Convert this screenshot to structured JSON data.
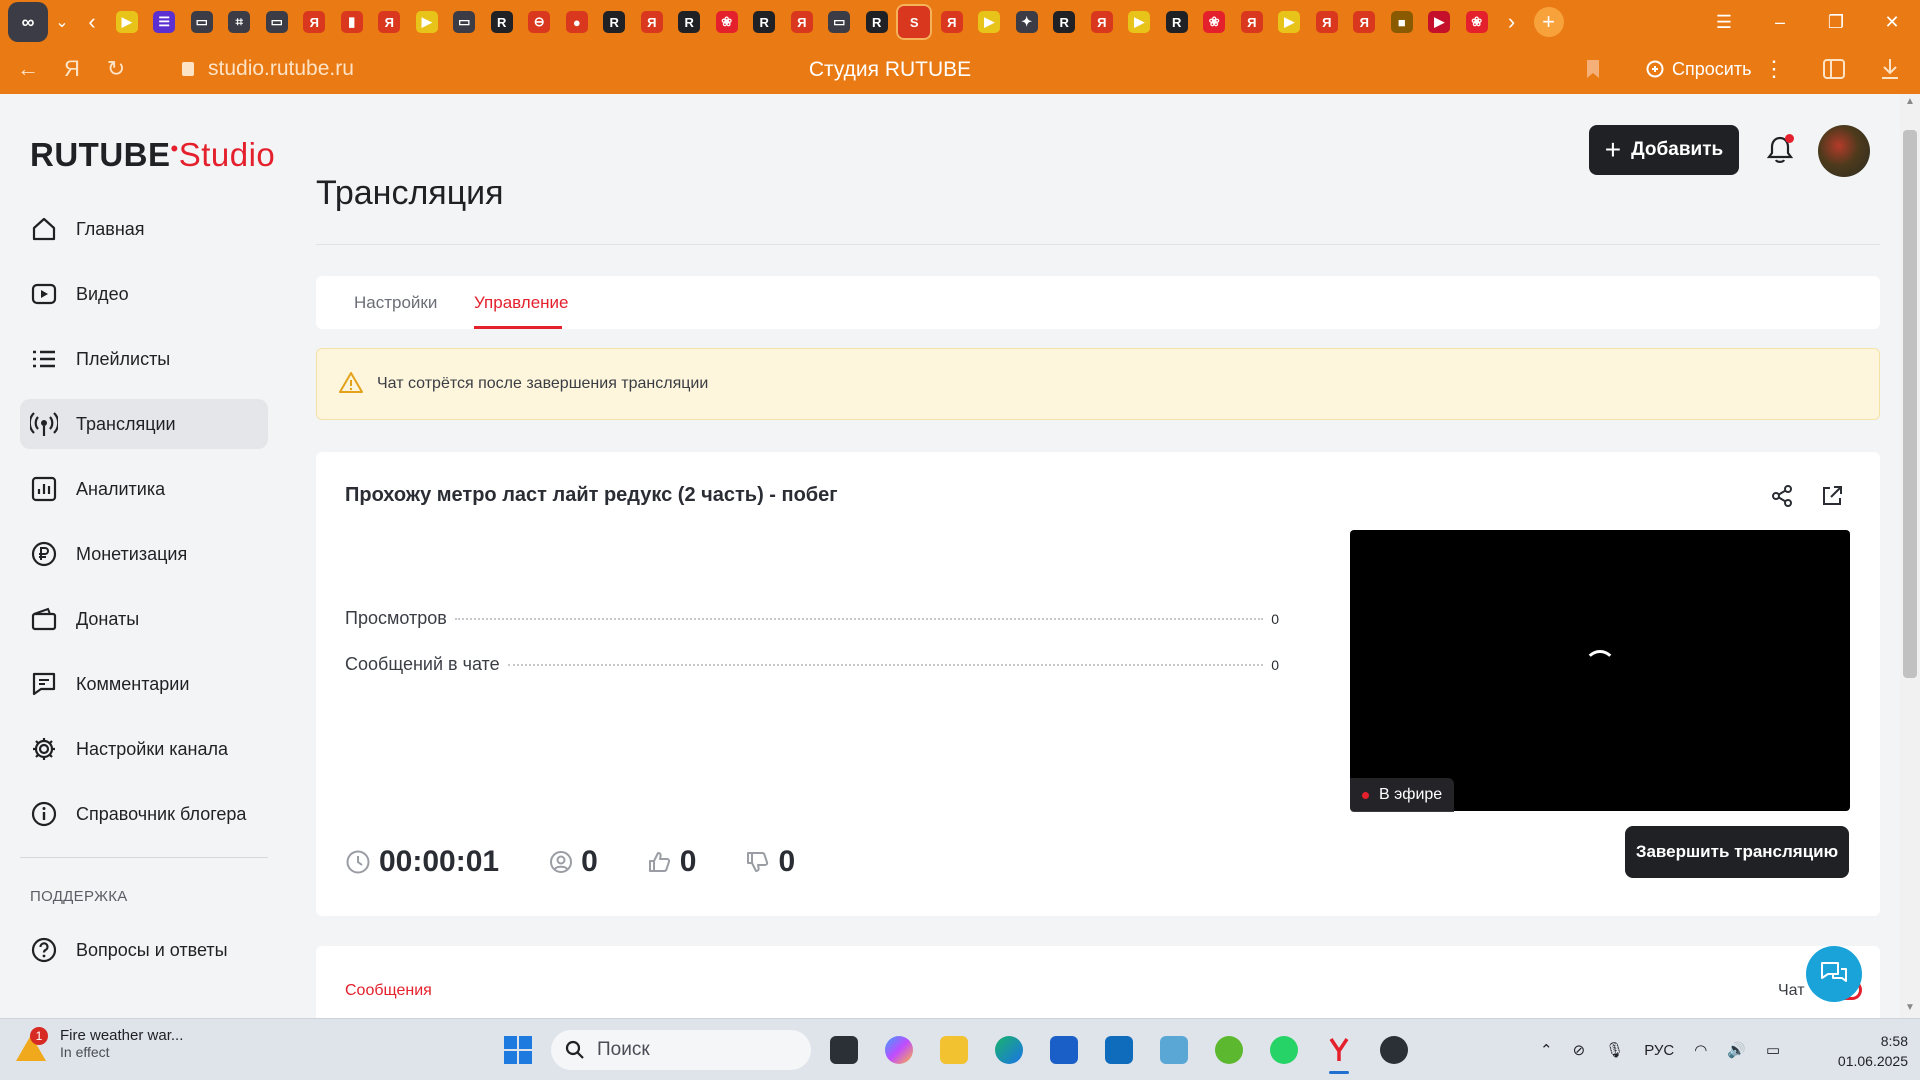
{
  "browser": {
    "url": "studio.rutube.ru",
    "title": "Студия RUTUBE",
    "ask_label": "Спросить",
    "tab_glyphs": [
      "▶",
      "☰",
      "▭",
      "⌗",
      "▭",
      "Я",
      "▮",
      "Я",
      "▶",
      "▭",
      "R",
      "⊖",
      "●",
      "R",
      "Я",
      "R",
      "❀",
      "R",
      "Я",
      "▭",
      "R",
      "S",
      "Я",
      "▶",
      "✦",
      "R",
      "Я",
      "▶",
      "R",
      "❀",
      "Я",
      "▶",
      "Я",
      "Я",
      "■",
      "▶",
      "❀"
    ],
    "tab_colors": [
      "#e8c41a",
      "#5b2fd0",
      "#3c3c46",
      "#3c3c46",
      "#3c3c46",
      "#d9381e",
      "#d9381e",
      "#d9381e",
      "#e8c41a",
      "#3c3c46",
      "#1f2125",
      "#d9381e",
      "#d9381e",
      "#1f2125",
      "#d9381e",
      "#1f2125",
      "#e4202d",
      "#1f2125",
      "#d9381e",
      "#3c3c46",
      "#1f2125",
      "#d9381e",
      "#d9381e",
      "#e8c41a",
      "#3c3c46",
      "#1f2125",
      "#d9381e",
      "#e8c41a",
      "#1f2125",
      "#e4202d",
      "#d9381e",
      "#e8c41a",
      "#d9381e",
      "#d9381e",
      "#8a5a00",
      "#c4102a",
      "#e4202d"
    ]
  },
  "header": {
    "logo_main": "RUTUBE",
    "logo_accent": "Studio",
    "add_label": "Добавить"
  },
  "sidebar": {
    "items": [
      {
        "label": "Главная",
        "icon": "home-icon"
      },
      {
        "label": "Видео",
        "icon": "video-icon"
      },
      {
        "label": "Плейлисты",
        "icon": "playlist-icon"
      },
      {
        "label": "Трансляции",
        "icon": "broadcast-icon",
        "active": true
      },
      {
        "label": "Аналитика",
        "icon": "analytics-icon"
      },
      {
        "label": "Монетизация",
        "icon": "ruble-icon"
      },
      {
        "label": "Донаты",
        "icon": "wallet-icon"
      },
      {
        "label": "Комментарии",
        "icon": "comment-icon"
      },
      {
        "label": "Настройки канала",
        "icon": "gear-icon"
      },
      {
        "label": "Справочник блогера",
        "icon": "info-icon"
      }
    ],
    "support_title": "ПОДДЕРЖКА",
    "support_items": [
      {
        "label": "Вопросы и ответы",
        "icon": "question-icon"
      }
    ]
  },
  "main": {
    "page_title": "Трансляция",
    "tabs": [
      {
        "label": "Настройки"
      },
      {
        "label": "Управление",
        "active": true
      }
    ],
    "warning": "Чат сотрётся после завершения трансляции",
    "stream": {
      "title": "Прохожу метро ласт лайт редукс (2 часть) - побег",
      "stats": [
        {
          "label": "Просмотров",
          "value": "0"
        },
        {
          "label": "Сообщений в чате",
          "value": "0"
        }
      ],
      "live_label": "В эфире",
      "duration": "00:00:01",
      "viewers": "0",
      "likes": "0",
      "dislikes": "0",
      "end_button": "Завершить трансляцию"
    },
    "messages": {
      "title": "Сообщения",
      "chat_label": "Чат",
      "chat_enabled": true
    }
  },
  "taskbar": {
    "weather_title": "Fire weather war...",
    "weather_sub": "In effect",
    "weather_badge": "1",
    "search_placeholder": "Поиск",
    "lang": "РУС",
    "time": "8:58",
    "date": "01.06.2025"
  },
  "colors": {
    "brand_red": "#e4202d",
    "browser_orange": "#ea7a13"
  }
}
